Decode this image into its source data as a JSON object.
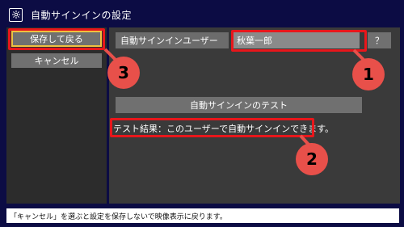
{
  "window": {
    "title": "自動サインインの設定",
    "icon": "gear-icon"
  },
  "left_panel": {
    "save_button": "保存して戻る",
    "cancel_button": "キャンセル"
  },
  "settings": {
    "user_label": "自動サインインユーザー",
    "user_value": "秋葉一郎",
    "help_button": "？",
    "test_button": "自動サインインのテスト",
    "test_result": "テスト結果：このユーザーで自動サインインできます。"
  },
  "status_bar": {
    "text": "「キャンセル」を選ぶと設定を保存しないで映像表示に戻ります。"
  },
  "annotations": {
    "marker_1": "1",
    "marker_2": "2",
    "marker_3": "3"
  },
  "colors": {
    "highlight": "#e8161b",
    "marker": "#e8504a",
    "focus": "#f0c040",
    "frame": "#0c0c44"
  }
}
